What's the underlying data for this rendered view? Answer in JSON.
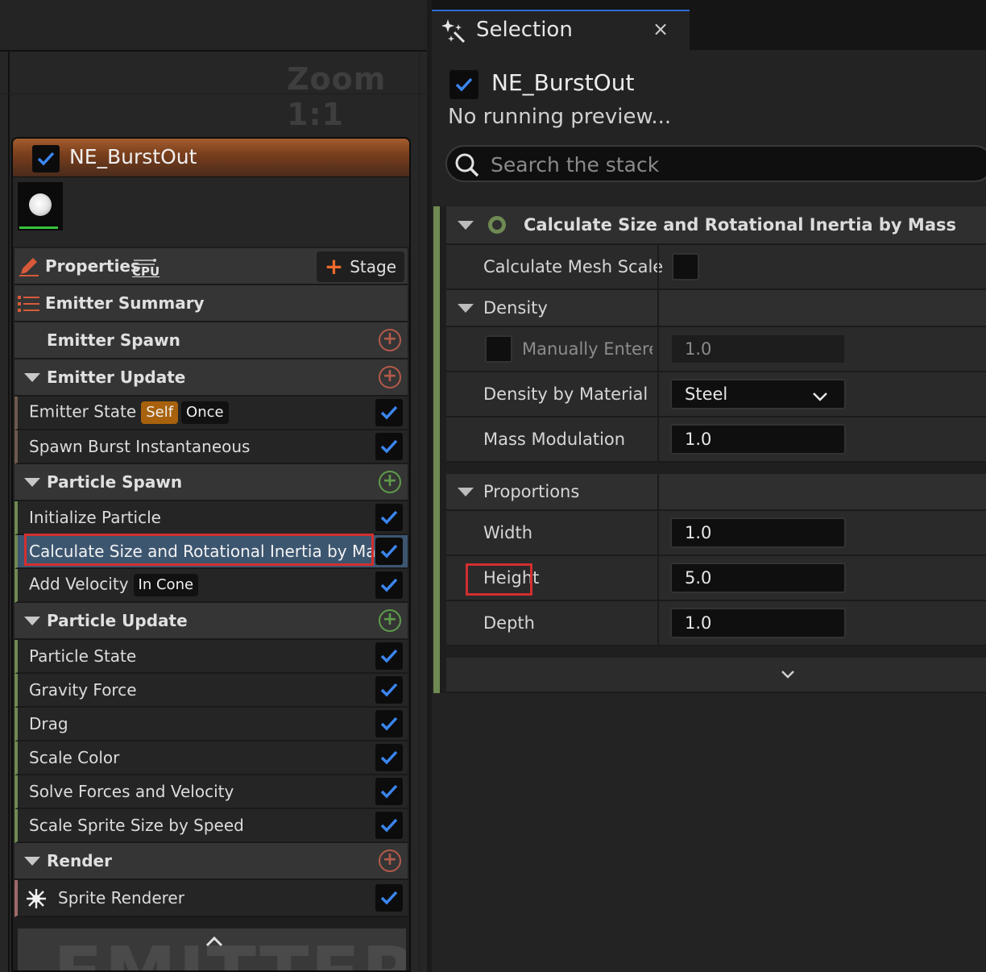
{
  "graph": {
    "zoom_label": "Zoom 1:1",
    "node": {
      "title": "NE_BurstOut",
      "properties_label": "Properties",
      "sim_target": "CPU",
      "stage_label": "Stage",
      "rows": {
        "emitter_summary": "Emitter Summary",
        "emitter_spawn": "Emitter Spawn",
        "emitter_update": "Emitter Update",
        "emitter_state": "Emitter State",
        "emitter_state_tag_self": "Self",
        "emitter_state_tag_once": "Once",
        "spawn_burst": "Spawn Burst Instantaneous",
        "particle_spawn": "Particle Spawn",
        "initialize_particle": "Initialize Particle",
        "calc_size": "Calculate Size and Rotational Inertia by Mass",
        "add_velocity": "Add Velocity",
        "add_velocity_tag": "In Cone",
        "particle_update": "Particle Update",
        "particle_state": "Particle State",
        "gravity_force": "Gravity Force",
        "drag": "Drag",
        "scale_color": "Scale Color",
        "solve_forces": "Solve Forces and Velocity",
        "scale_sprite": "Scale Sprite Size by Speed",
        "render": "Render",
        "sprite_renderer": "Sprite Renderer"
      },
      "footer_text": "EMITTER"
    }
  },
  "panel": {
    "tab_title": "Selection",
    "tab_close": "×",
    "emitter_name": "NE_BurstOut",
    "status": "No running preview...",
    "search_placeholder": "Search the stack",
    "module": {
      "title": "Calculate Size and Rotational Inertia by Mass",
      "calc_mesh_scale": "Calculate Mesh Scale",
      "density": "Density",
      "manually_entered": "Manually Enterec",
      "manually_entered_value": "1.0",
      "density_by_material": "Density by Material Ty",
      "density_material_value": "Steel",
      "mass_modulation": "Mass Modulation",
      "mass_modulation_value": "1.0",
      "proportions": "Proportions",
      "width": "Width",
      "width_value": "1.0",
      "height": "Height",
      "height_value": "5.0",
      "depth": "Depth",
      "depth_value": "1.0"
    }
  },
  "colors": {
    "accent_blue": "#2d6cd6",
    "checkbox_check": "#3b86f0",
    "highlight_red": "#d32f2f",
    "green_bar": "#6f8a52",
    "orange_tag": "#a8610c"
  }
}
